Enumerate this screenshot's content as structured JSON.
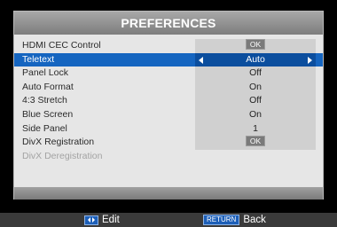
{
  "dialog": {
    "title": "PREFERENCES",
    "items": [
      {
        "label": "HDMI CEC Control",
        "value": "OK",
        "value_type": "button"
      },
      {
        "label": "Teletext",
        "value": "Auto",
        "value_type": "selector",
        "selected": true
      },
      {
        "label": "Panel Lock",
        "value": "Off"
      },
      {
        "label": "Auto Format",
        "value": "On"
      },
      {
        "label": "4:3 Stretch",
        "value": "Off"
      },
      {
        "label": "Blue Screen",
        "value": "On"
      },
      {
        "label": "Side Panel",
        "value": "1"
      },
      {
        "label": "DivX Registration",
        "value": "OK",
        "value_type": "button"
      },
      {
        "label": "DivX Deregistration",
        "disabled": true
      }
    ]
  },
  "hints": {
    "edit_label": "Edit",
    "return_key": "RETURN",
    "back_label": "Back"
  },
  "colors": {
    "selection": "#1565c0",
    "dialog_bg": "#e6e6e6",
    "header": "#8f8f8f",
    "value_cell": "#d0d0d0"
  },
  "icons": {
    "edit": "left-right-arrows-icon",
    "selector_left": "arrow-left-icon",
    "selector_right": "arrow-right-icon"
  }
}
